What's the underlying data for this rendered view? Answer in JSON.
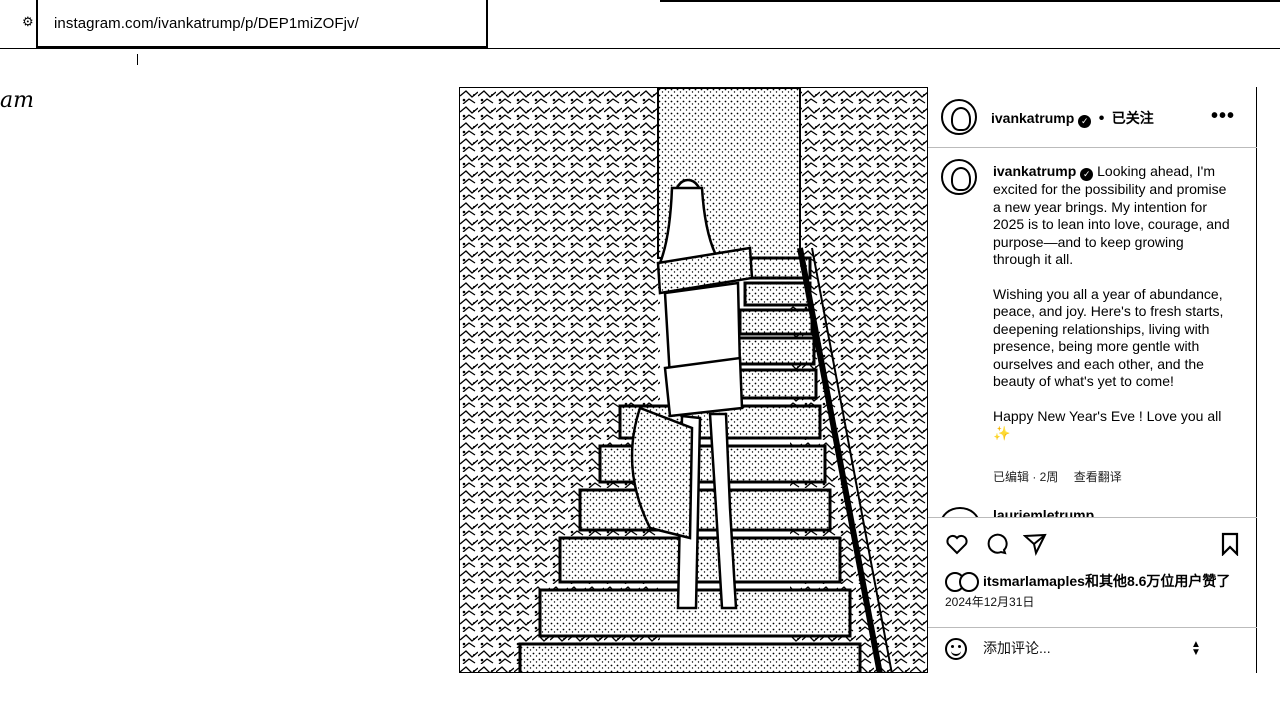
{
  "browser": {
    "url": "instagram.com/ivankatrump/p/DEP1miZOFjv/"
  },
  "brand_partial": "am",
  "post": {
    "image_label": "Ivanka Trump standing on outdoor stone staircase",
    "header": {
      "username": "ivankatrump",
      "separator": "•",
      "follow_status": "已关注"
    },
    "caption": {
      "username": "ivankatrump",
      "paragraphs": [
        "Looking ahead, I'm excited for the possibility and promise a new year brings. My intention for 2025 is to lean into love, courage, and purpose—and to keep growing through it all.",
        "Wishing you all a year of abundance, peace, and joy. Here's to fresh starts, deepening relationships, living with presence, being more gentle with ourselves and each other, and the beauty of what's yet to come!",
        "Happy New Year's Eve ! Love you all ✨"
      ],
      "edited": "已编辑 · 2周",
      "translate": "查看翻译"
    },
    "next_comment_user": "lauriemletrump",
    "likes_text": "itsmarlamaples和其他8.6万位用户赞了",
    "date": "2024年12月31日",
    "comment_placeholder": "添加评论..."
  }
}
